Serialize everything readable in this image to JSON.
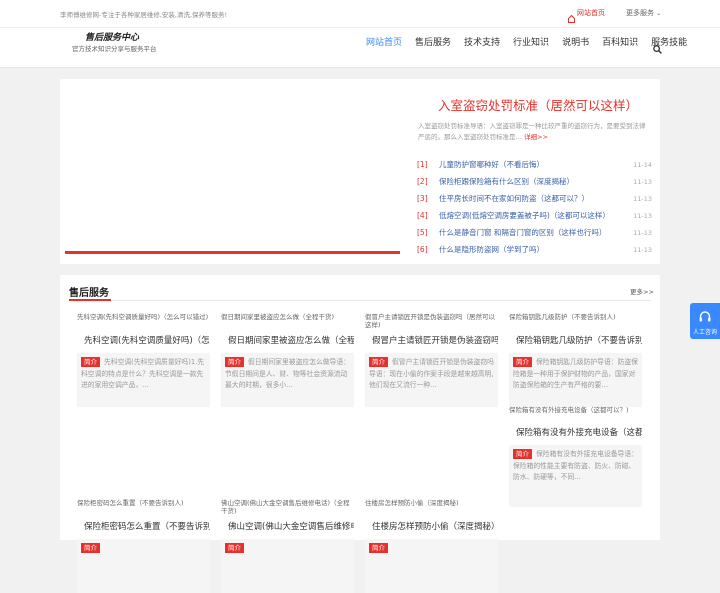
{
  "topbar": {
    "tagline": "李师傅维修网-专注于各种家居维修,安装,清洗,保养等服务!",
    "home_link": "网站首页",
    "more_link": "更多服务"
  },
  "header": {
    "logo": "售后服务中心",
    "logo_sub": "官方技术知识分享与服务平台"
  },
  "nav": [
    "网站首页",
    "售后服务",
    "技术支持",
    "行业知识",
    "说明书",
    "百科知识",
    "服务技能"
  ],
  "featured": {
    "title": "入室盗窃处罚标准（居然可以这样）",
    "desc": "入室盗窃处罚标准导语：入室盗窃罪是一种比较严重的盗窃行为，是要受到法律严惩的。那么入室盗窃处罚标准是…",
    "more": "详细>>"
  },
  "headlines": [
    {
      "num": "[1]",
      "title": "儿童防护窗哪种好（不看后悔）",
      "date": "11-14"
    },
    {
      "num": "[2]",
      "title": "保险柜跟保险箱有什么区别（深度揭秘）",
      "date": "11-13"
    },
    {
      "num": "[3]",
      "title": "住平房长时间不在家如何防盗（这都可以？）",
      "date": "11-13"
    },
    {
      "num": "[4]",
      "title": "低熔空调(低熔空调房要盖被子吗)（这都可以这样）",
      "date": "11-13"
    },
    {
      "num": "[5]",
      "title": "什么是静音门窗 和隔音门窗的区别（这样也行吗）",
      "date": "11-13"
    },
    {
      "num": "[6]",
      "title": "什么是隐形防盗网（学到了吗）",
      "date": "11-13"
    }
  ],
  "section": {
    "title": "售后服务",
    "more": "更多>>",
    "badge": "简介",
    "cards": [
      {
        "alt": "先科空调(先科空调质量好吗)（怎么可以错过)",
        "title": "先科空调(先科空调质量好吗)（怎",
        "desc": "先科空调(先科空调质量好吗)1.先科空调的特点是什么？先科空调是一款先进的家用空调产品，…"
      },
      {
        "alt": "假日期间家里被盗应怎么做（全程干货)",
        "title": "假日期间家里被盗应怎么做（全程",
        "desc": "假日期间家里被盗应怎么做导语：节假日期间是人、财、物等社会资源流动最大的时期，很多小…"
      },
      {
        "alt": "假冒户主请锁匠开锁是伪装盗窃吗（居然可以这样)",
        "title": "假冒户主请锁匠开锁是伪装盗窃吗",
        "desc": "假冒户主请锁匠开锁是伪装盗窃吗导语：现在小偷的作案手段是越来越高明,他们现在又流行一种…"
      },
      {
        "alt": "保险箱钥匙几级防护（不要告诉别人)",
        "title": "保险箱钥匙几级防护（不要告诉别",
        "desc": "保险箱钥匙几级防护导语：防盗保险箱是一种用于保护财物的产品，国家对防盗保险箱的生产有严格的要…"
      },
      {
        "alt": "保险箱有没有外接充电设备（这都可以？)",
        "title": "保险箱有没有外接充电设备（这都",
        "desc": "保险箱有没有外接充电设备导语：保险箱的性能主要有防盗、防火、防磁、防水、防硬等，不同…"
      },
      {
        "alt": "保险柜密码怎么重置（不要告诉别人)",
        "title": "保险柜密码怎么重置（不要告诉别",
        "desc": ""
      },
      {
        "alt": "佛山空调(佛山大金空调售后维修电话)（全程干货)",
        "title": "佛山空调(佛山大金空调售后维修电",
        "desc": ""
      },
      {
        "alt": "住楼房怎样预防小偷（深度揭秘)",
        "title": "住楼房怎样预防小偷（深度揭秘）",
        "desc": ""
      }
    ]
  },
  "float_button": {
    "label": "人工咨询"
  },
  "colors": {
    "accent": "#e5322d",
    "brand_blue": "#3a88fd",
    "link": "#3a60a8"
  }
}
